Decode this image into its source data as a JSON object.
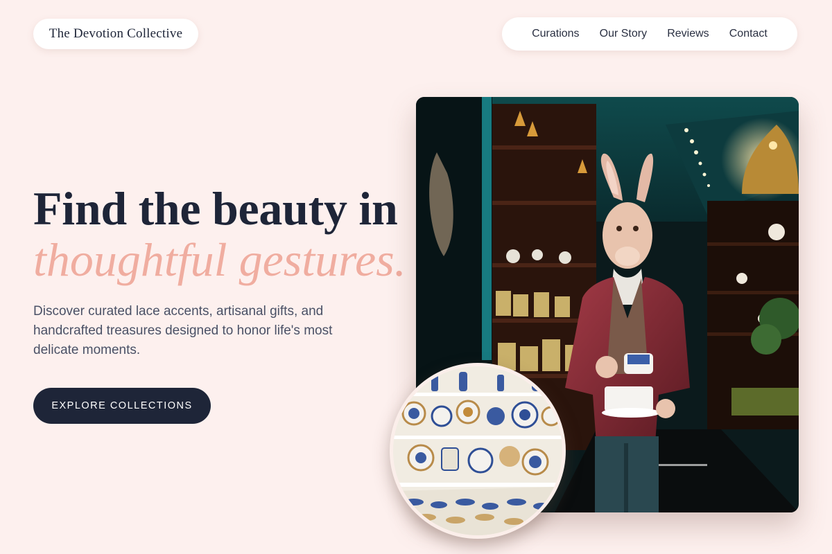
{
  "brand": {
    "name": "The Devotion Collective"
  },
  "nav": {
    "items": [
      {
        "label": "Curations"
      },
      {
        "label": "Our Story"
      },
      {
        "label": "Reviews"
      },
      {
        "label": "Contact"
      }
    ]
  },
  "hero": {
    "title_line1": "Find the beauty in",
    "title_line2": "thoughtful gestures.",
    "description": "Discover curated lace accents, artisanal gifts, and handcrafted treasures designed to honor life's most delicate moments.",
    "cta_label": "EXPLORE COLLECTIONS"
  },
  "colors": {
    "background": "#fdf0ee",
    "navy": "#1e2538",
    "accent_pink": "#f0ada0",
    "body_text": "#4a5166"
  }
}
